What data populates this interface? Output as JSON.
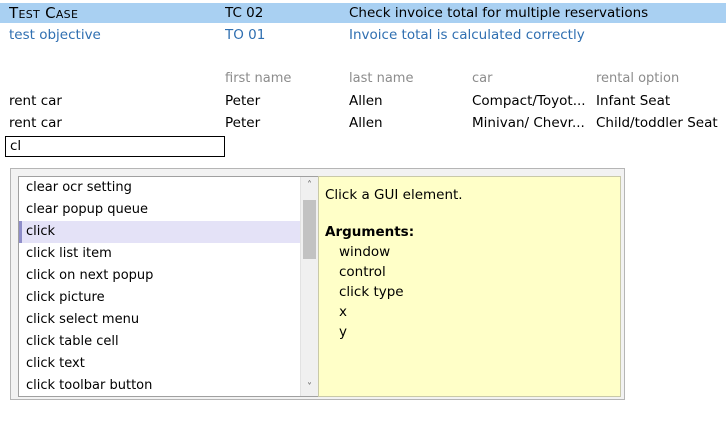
{
  "test_case": {
    "label": "Test Case",
    "id": "TC 02",
    "description": "Check invoice total for multiple reservations"
  },
  "test_objective": {
    "label": "test objective",
    "id": "TO 01",
    "description": "Invoice total is calculated correctly"
  },
  "columns": [
    "first name",
    "last name",
    "car",
    "rental option"
  ],
  "rows": [
    {
      "action": "rent car",
      "first_name": "Peter",
      "last_name": "Allen",
      "car": "Compact/Toyot...",
      "rental_option": "Infant Seat"
    },
    {
      "action": "rent car",
      "first_name": "Peter",
      "last_name": "Allen",
      "car": "Minivan/ Chevr...",
      "rental_option": "Child/toddler Seat"
    }
  ],
  "input": {
    "value": "cl"
  },
  "autocomplete": {
    "items": [
      "clear ocr setting",
      "clear popup queue",
      "click",
      "click list item",
      "click on next popup",
      "click picture",
      "click select menu",
      "click table cell",
      "click text",
      "click toolbar button"
    ],
    "selected_index": 2,
    "scroll_up_glyph": "˄",
    "scroll_down_glyph": "˅"
  },
  "help": {
    "description": "Click a GUI element.",
    "arguments_title": "Arguments:",
    "arguments": [
      "window",
      "control",
      "click type",
      "x",
      "y"
    ]
  },
  "colors": {
    "test_case_highlight": "#a9d0f2",
    "objective_text": "#2f6fb1",
    "help_background": "#ffffc8",
    "selected_item": "#e4e2f7"
  }
}
